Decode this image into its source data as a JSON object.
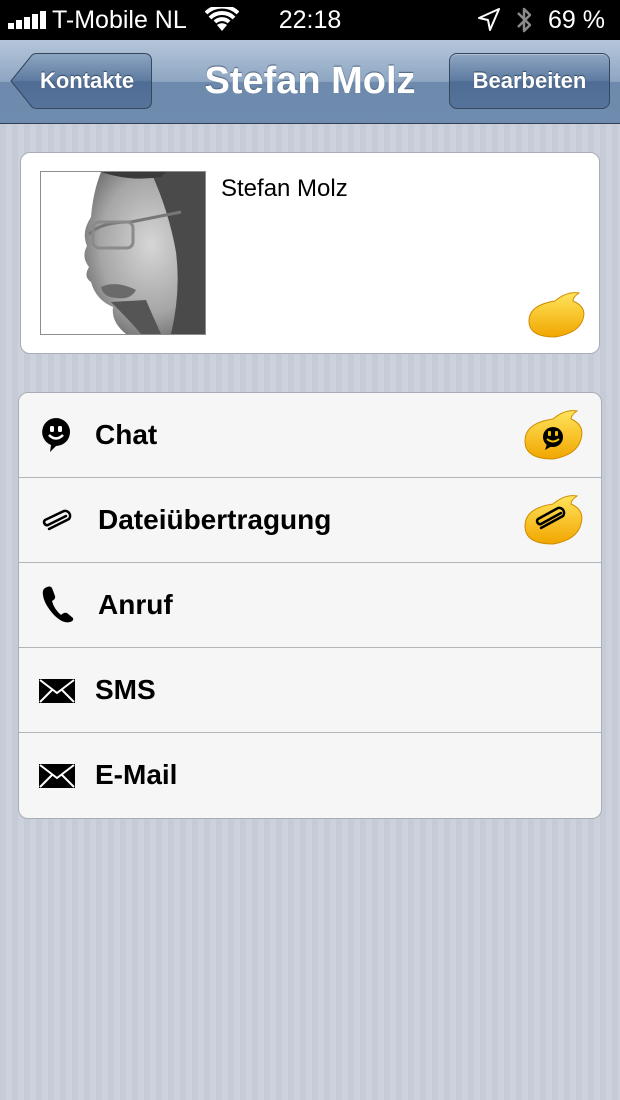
{
  "status_bar": {
    "carrier": "T-Mobile NL",
    "time": "22:18",
    "battery": "69 %",
    "icons": [
      "signal-icon",
      "wifi-icon",
      "location-arrow-icon",
      "bluetooth-icon"
    ]
  },
  "navbar": {
    "back_label": "Kontakte",
    "title": "Stefan Molz",
    "edit_label": "Bearbeiten"
  },
  "contact": {
    "name": "Stefan Molz",
    "photo": "contact-photo",
    "status_icon": "yellow-chat-bubble-icon"
  },
  "actions": [
    {
      "label": "Chat",
      "icon": "chat-smiley-icon",
      "badge": "yellow-chat-bubble-smiley-icon"
    },
    {
      "label": "Dateiübertragung",
      "icon": "paperclip-icon",
      "badge": "yellow-chat-bubble-paperclip-icon"
    },
    {
      "label": "Anruf",
      "icon": "phone-icon"
    },
    {
      "label": "SMS",
      "icon": "envelope-icon"
    },
    {
      "label": "E-Mail",
      "icon": "envelope-icon"
    }
  ],
  "colors": {
    "navbar": "#6f8cae",
    "background": "#c9ceda",
    "bubble": "#f7c400"
  }
}
